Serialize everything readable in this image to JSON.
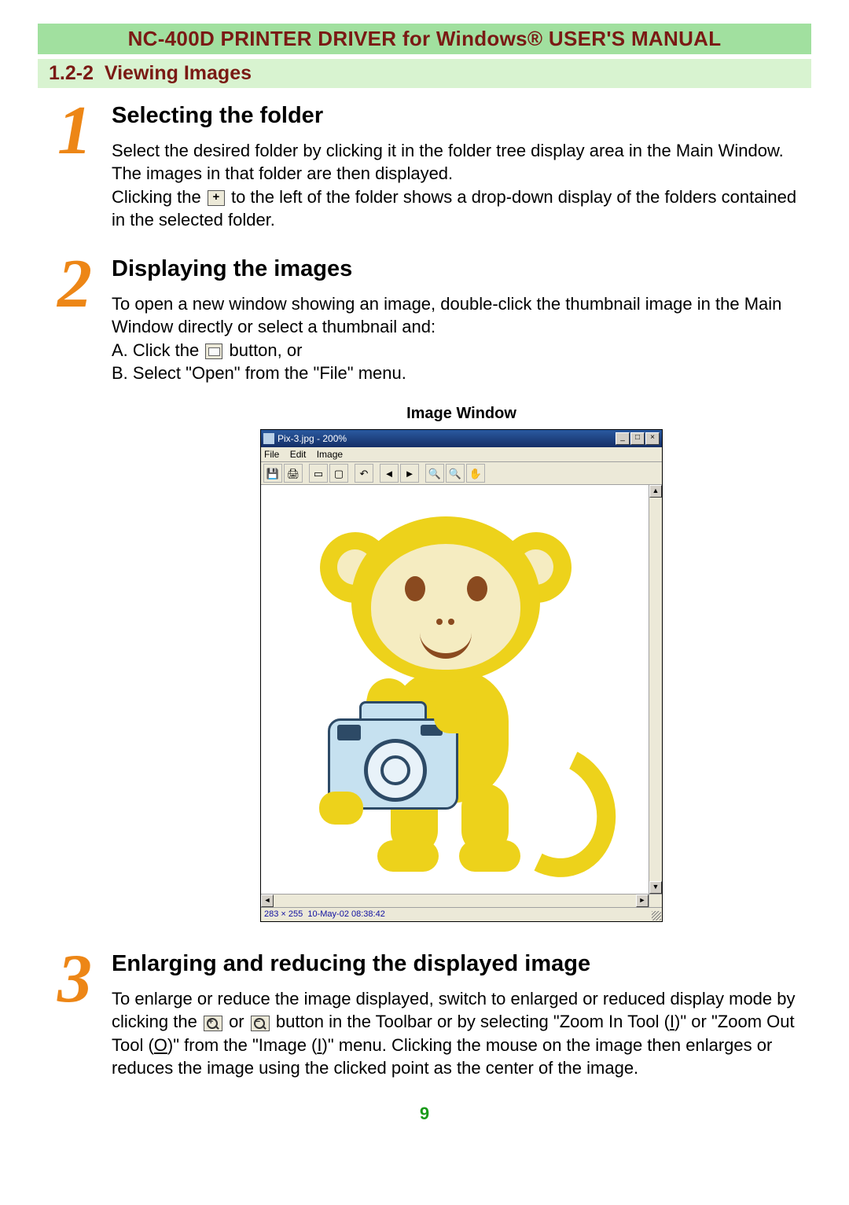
{
  "title_bar": "NC-400D PRINTER DRIVER for Windows® USER'S MANUAL",
  "section": {
    "number": "1.2-2",
    "title": "Viewing Images"
  },
  "steps": [
    {
      "num": "1",
      "heading": "Selecting the folder",
      "p1": "Select the desired folder by clicking it in the folder tree display area in the Main Window. The images in that folder are then displayed.",
      "p2a": "Clicking the ",
      "p2b": " to the left of the folder shows a drop-down display of the folders contained in the selected folder."
    },
    {
      "num": "2",
      "heading": "Displaying the images",
      "p1": "To open a new window showing an image, double-click the thumbnail image in the Main Window directly or select a thumbnail and:",
      "la": "A. Click the ",
      "la2": " button, or",
      "lb": "B. Select \"Open\" from the \"File\" menu."
    },
    {
      "num": "3",
      "heading": "Enlarging and reducing the displayed image",
      "p1a": "To enlarge or reduce the image displayed, switch to enlarged or reduced display mode by clicking the ",
      "p1b": " or ",
      "p1c": " button in the Toolbar or by selecting \"Zoom In Tool (",
      "p1c_u": "I",
      "p1d": ")\" or \"Zoom Out Tool (",
      "p1d_u": "O",
      "p1e": ")\" from the \"Image (",
      "p1e_u": "I",
      "p1f": ")\" menu. Clicking the mouse on the image then enlarges or reduces the image using the clicked point as the center of the image."
    }
  ],
  "image_window": {
    "caption": "Image Window",
    "title": "Pix-3.jpg - 200%",
    "menu": [
      "File",
      "Edit",
      "Image"
    ],
    "status_dims": "283 × 255",
    "status_date": "10-May-02 08:38:42"
  },
  "page_number": "9"
}
